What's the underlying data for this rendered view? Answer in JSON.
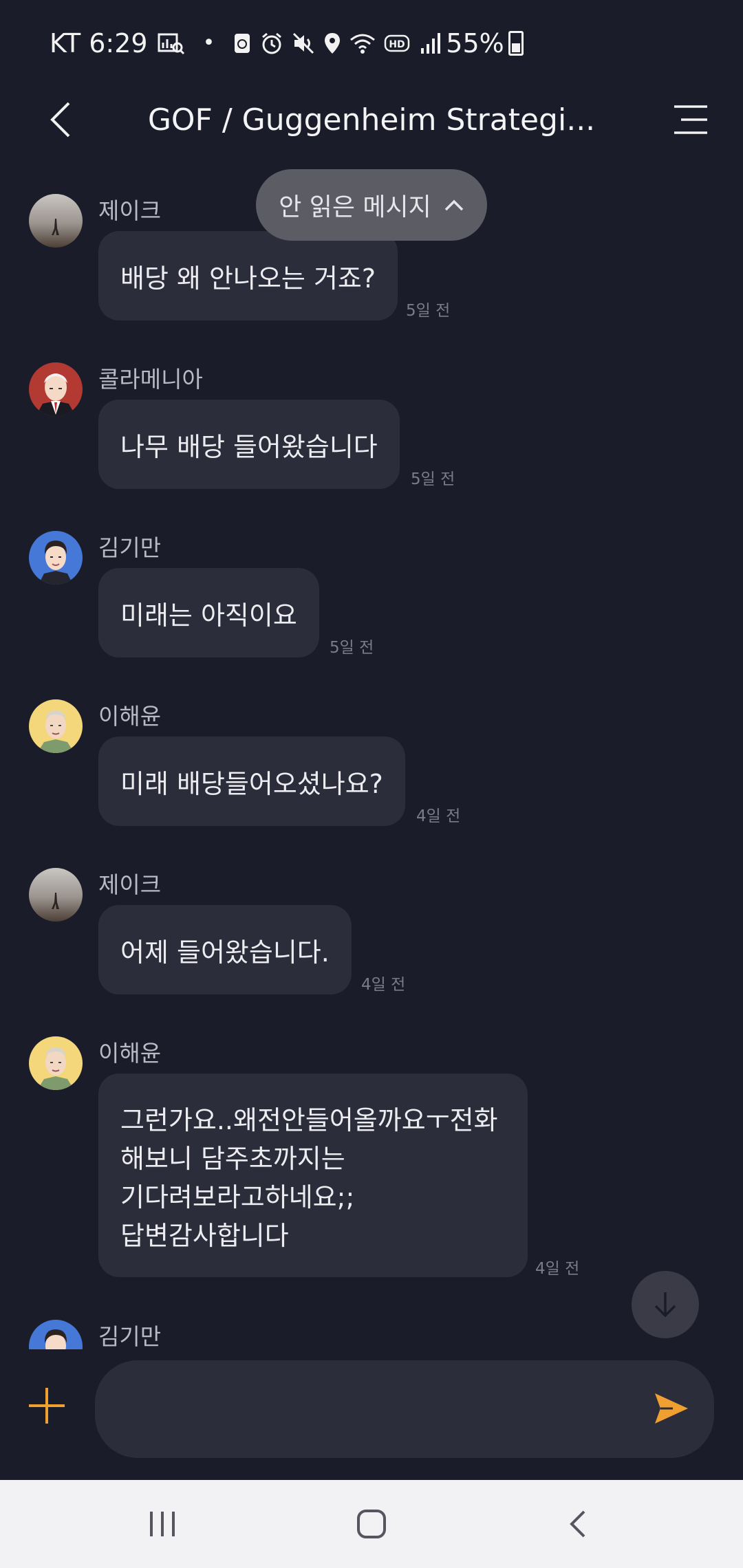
{
  "status_bar": {
    "carrier_time": "KT 6:29",
    "battery": "55%"
  },
  "header": {
    "title": "GOF / Guggenheim Strategi..."
  },
  "unread_pill": {
    "label": "안 읽은 메시지"
  },
  "messages": [
    {
      "sender": "제이크",
      "text": "배당 왜 안나오는 거죠?",
      "time": "5일 전",
      "avatar": "landscape-photo"
    },
    {
      "sender": "콜라메니아",
      "text": "나무 배당 들어왔습니다",
      "time": "5일 전",
      "avatar": "old-man-suit-illustration"
    },
    {
      "sender": "김기만",
      "text": "미래는 아직이요",
      "time": "5일 전",
      "avatar": "young-man-illustration"
    },
    {
      "sender": "이해윤",
      "text": "미래 배당들어오셨나요?",
      "time": "4일 전",
      "avatar": "old-man-yellow-illustration"
    },
    {
      "sender": "제이크",
      "text": "어제 들어왔습니다.",
      "time": "4일 전",
      "avatar": "landscape-photo"
    },
    {
      "sender": "이해윤",
      "lines": [
        "그런가요..왜전안들어올까요ㅜ전화",
        "해보니 담주초까지는",
        "기다려보라고하네요;;",
        "답변감사합니다"
      ],
      "time": "4일 전",
      "avatar": "old-man-yellow-illustration"
    },
    {
      "sender": "김기만",
      "avatar": "young-man-illustration"
    }
  ],
  "composer": {
    "placeholder": ""
  },
  "icons": {
    "back": "chevron-left-icon",
    "menu": "menu-icon",
    "add": "plus-icon",
    "send": "send-icon",
    "scroll_down": "arrow-down-icon"
  },
  "colors": {
    "background": "#1b1c29",
    "bubble": "#2c2d3b",
    "accent": "#f0a030"
  }
}
